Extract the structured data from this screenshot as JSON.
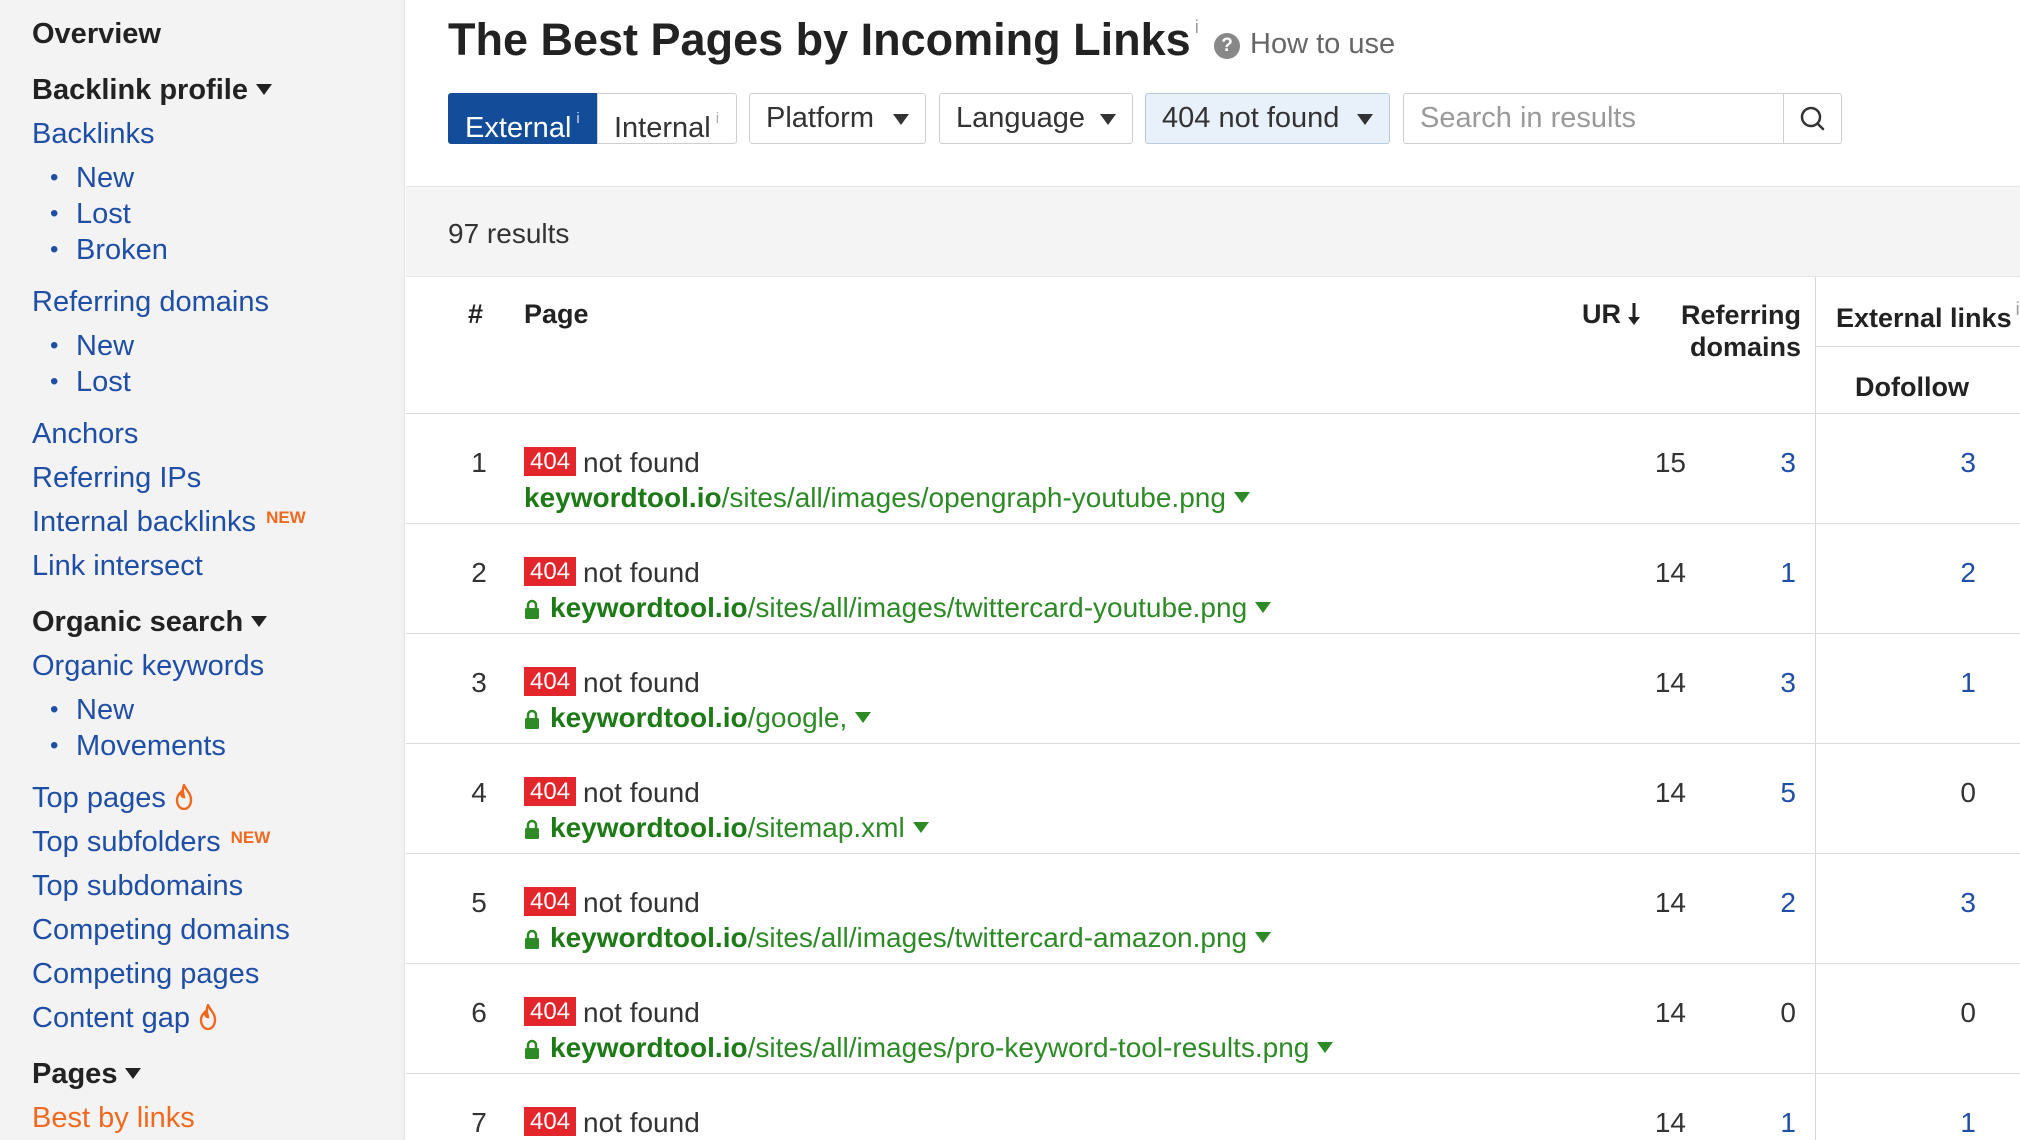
{
  "sidebar": {
    "overview": "Overview",
    "backlink_profile": "Backlink profile",
    "backlinks": "Backlinks",
    "backlinks_sub": [
      "New",
      "Lost",
      "Broken"
    ],
    "referring_domains": "Referring domains",
    "referring_domains_sub": [
      "New",
      "Lost"
    ],
    "anchors": "Anchors",
    "referring_ips": "Referring IPs",
    "internal_backlinks": "Internal backlinks",
    "new_badge": "NEW",
    "link_intersect": "Link intersect",
    "organic_search": "Organic search",
    "organic_keywords": "Organic keywords",
    "organic_keywords_sub": [
      "New",
      "Movements"
    ],
    "top_pages": "Top pages",
    "top_subfolders": "Top subfolders",
    "top_subdomains": "Top subdomains",
    "competing_domains": "Competing domains",
    "competing_pages": "Competing pages",
    "content_gap": "Content gap",
    "pages": "Pages",
    "best_by_links": "Best by links"
  },
  "header": {
    "title": "The Best Pages by Incoming Links",
    "title_info": "i",
    "how_to_use": "How to use"
  },
  "filters": {
    "external": "External",
    "internal": "Internal",
    "info": "i",
    "platform": "Platform",
    "language": "Language",
    "status": "404 not found",
    "search_placeholder": "Search in results"
  },
  "results": {
    "count": "97 results"
  },
  "table": {
    "headers": {
      "num": "#",
      "page": "Page",
      "ur": "UR",
      "ref_domains_line1": "Referring",
      "ref_domains_line2": "domains",
      "external_links": "External links",
      "external_links_info": "i",
      "dofollow": "Dofollow"
    },
    "rows": [
      {
        "num": "1",
        "code": "404",
        "status": "not found",
        "domain": "keywordtool.io",
        "path": "/sites/all/images/opengraph-youtube.png",
        "ur": "15",
        "ref_domains": "3",
        "dofollow": "3"
      },
      {
        "num": "2",
        "code": "404",
        "status": "not found",
        "domain": "keywordtool.io",
        "path": "/sites/all/images/twittercard-youtube.png",
        "ur": "14",
        "ref_domains": "1",
        "dofollow": "2"
      },
      {
        "num": "3",
        "code": "404",
        "status": "not found",
        "domain": "keywordtool.io",
        "path": "/google,",
        "ur": "14",
        "ref_domains": "3",
        "dofollow": "1"
      },
      {
        "num": "4",
        "code": "404",
        "status": "not found",
        "domain": "keywordtool.io",
        "path": "/sitemap.xml",
        "ur": "14",
        "ref_domains": "5",
        "dofollow": "0"
      },
      {
        "num": "5",
        "code": "404",
        "status": "not found",
        "domain": "keywordtool.io",
        "path": "/sites/all/images/twittercard-amazon.png",
        "ur": "14",
        "ref_domains": "2",
        "dofollow": "3"
      },
      {
        "num": "6",
        "code": "404",
        "status": "not found",
        "domain": "keywordtool.io",
        "path": "/sites/all/images/pro-keyword-tool-results.png",
        "ur": "14",
        "ref_domains": "0",
        "dofollow": "0"
      },
      {
        "num": "7",
        "code": "404",
        "status": "not found",
        "ur": "14",
        "ref_domains": "1",
        "dofollow": "1"
      }
    ]
  },
  "colors": {
    "brand_blue": "#134d99",
    "link_blue": "#1f4ea5",
    "url_green": "#2d8a26",
    "badge_red": "#e3262b",
    "accent_orange": "#ef6a1f"
  }
}
